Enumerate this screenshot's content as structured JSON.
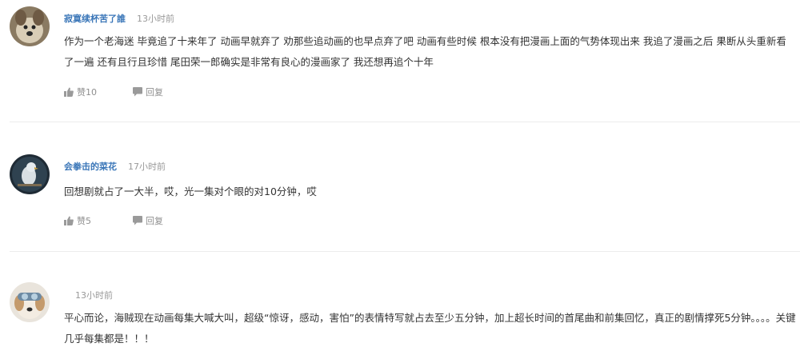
{
  "comments": [
    {
      "username": "寂寞续杯苦了誰",
      "time": "13小时前",
      "text": "作为一个老海迷 毕竟追了十来年了 动画早就弃了 劝那些追动画的也早点弃了吧 动画有些时候 根本没有把漫画上面的气势体现出来 我追了漫画之后 果断从头重新看了一遍 还有且行且珍惜 尾田荣一郎确实是非常有良心的漫画家了 我还想再追个十年",
      "like_label": "赞10",
      "reply_label": "回复",
      "avatar": "dog-avatar"
    },
    {
      "username": "会拳击的菜花",
      "time": "17小时前",
      "text": "回想剧就占了一大半，哎，光一集对个眼的对10分钟，哎",
      "like_label": "赞5",
      "reply_label": "回复",
      "avatar": "bird-avatar"
    },
    {
      "username": "",
      "time": "13小时前",
      "text": "平心而论，海贼现在动画每集大喊大叫，超级“惊讶，感动，害怕”的表情特写就占去至少五分钟，加上超长时间的首尾曲和前集回忆，真正的剧情撑死5分钟。。。。关键几乎每集都是！！！",
      "avatar": "dog-goggles-avatar"
    }
  ],
  "colors": {
    "username": "#3a76b8",
    "meta_gray": "#999999",
    "action_gray": "#8f8f8f",
    "divider": "#ececec"
  },
  "icons": [
    "thumbs-up-icon",
    "comment-bubble-icon"
  ]
}
